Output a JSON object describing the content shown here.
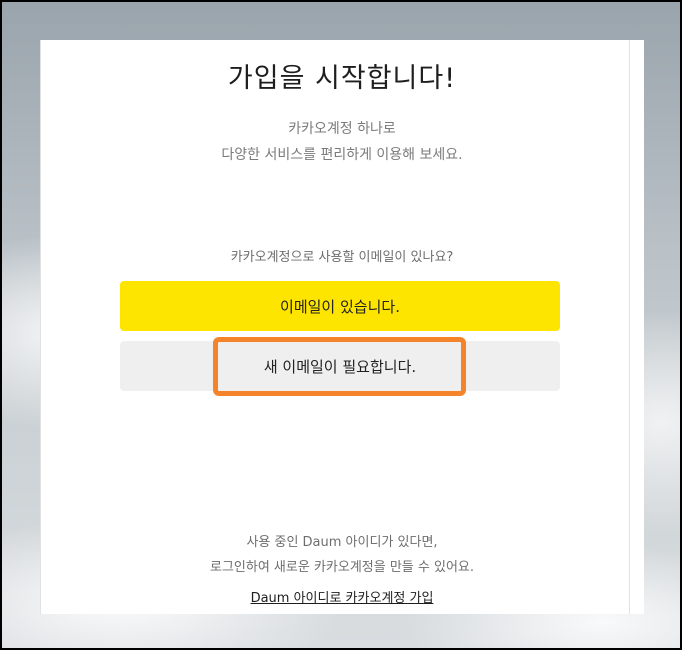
{
  "signup": {
    "title": "가입을 시작합니다!",
    "subtitle_line1": "카카오계정 하나로",
    "subtitle_line2": "다양한 서비스를 편리하게 이용해 보세요.",
    "question": "카카오계정으로 사용할 이메일이 있나요?",
    "have_email_button": "이메일이 있습니다.",
    "need_email_button": "새 이메일이 필요합니다."
  },
  "footer": {
    "line1": "사용 중인 Daum 아이디가 있다면,",
    "line2": "로그인하여 새로운 카카오계정을 만들 수 있어요.",
    "link": "Daum 아이디로 카카오계정 가입"
  },
  "colors": {
    "accent_yellow": "#fee500",
    "secondary_gray": "#efefef",
    "highlight_orange": "#f5832a"
  }
}
